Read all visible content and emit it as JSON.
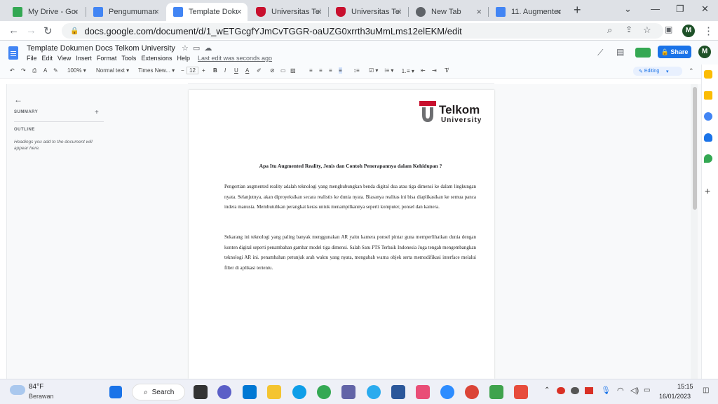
{
  "tabs": [
    {
      "title": "My Drive - Goo",
      "color": "#34a853"
    },
    {
      "title": "Pengumuman",
      "color": "#4285f4"
    },
    {
      "title": "Template Doku",
      "color": "#4285f4"
    },
    {
      "title": "Universitas Telk",
      "color": "#c8102e"
    },
    {
      "title": "Universitas Telk",
      "color": "#c8102e"
    },
    {
      "title": "New Tab",
      "color": "#5f6368"
    },
    {
      "title": "11. Augmented",
      "color": "#4285f4"
    }
  ],
  "address": {
    "url": "docs.google.com/document/d/1_wETGcgfYJmCvTGGR-oaUZG0xrrth3uMmLms12elEKM/edit"
  },
  "profile_initial": "M",
  "doc": {
    "title": "Template Dokumen Docs Telkom University",
    "menu": [
      "File",
      "Edit",
      "View",
      "Insert",
      "Format",
      "Tools",
      "Extensions",
      "Help"
    ],
    "last_edit": "Last edit was seconds ago",
    "share_label": "Share"
  },
  "toolbar": {
    "zoom": "100%",
    "style": "Normal text",
    "font": "Times New...",
    "size": "12",
    "mode": "Editing"
  },
  "outline": {
    "summary": "SUMMARY",
    "outline": "OUTLINE",
    "hint": "Headings you add to the document will appear here."
  },
  "logo": {
    "line1": "Telkom",
    "line2": "University"
  },
  "content": {
    "title": "Apa Itu Augmented Reality, Jenis dan Contoh Penerapannya dalam Kehidupan ?",
    "p1": "Pengertian augmented reality adalah teknologi yang menghubungkan benda digital dua atau tiga dimensi ke dalam lingkungan nyata. Selanjutnya, akan diproyeksikan secara realistis ke dunia nyata. Biasanya realitas ini bisa diaplikasikan ke semua panca indera manusia. Membutuhkan perangkat keras untuk menampilkannya seperti komputer, ponsel dan kamera.",
    "p2": "Sekarang ini teknologi yang paling banyak menggunakan AR yaitu kamera ponsel pintar guna memperlihatkan dunia dengan konten digital seperti penambahan gambar model tiga dimensi. Salah Satu PTS Terbaik Indonesia Juga tengah mengembangkan teknologi AR ini. penambahan petunjuk arah waktu yang nyata, mengubah warna objek serta memodifikasi interface melalui filter di aplikasi tertentu."
  },
  "taskbar": {
    "temp": "84°F",
    "weather": "Berawan",
    "search": "Search",
    "time": "15:15",
    "date": "16/01/2023"
  }
}
